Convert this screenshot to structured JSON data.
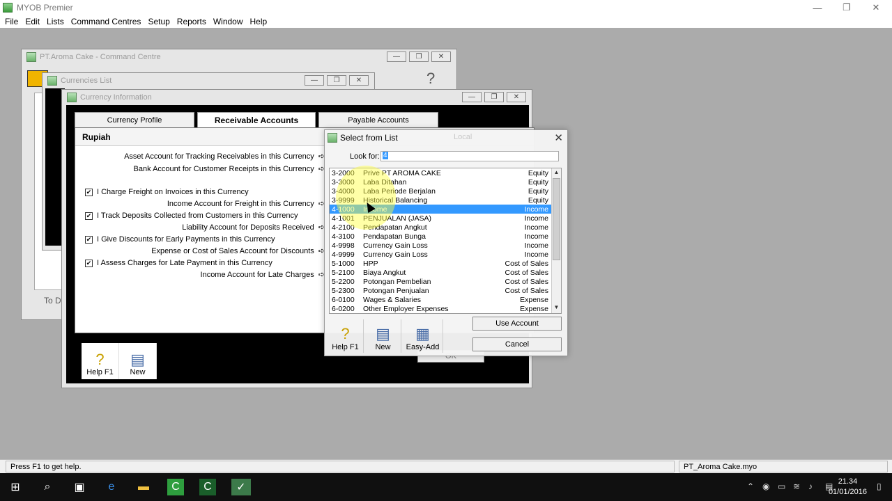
{
  "app": {
    "title": "MYOB Premier",
    "window_controls": [
      "—",
      "❐",
      "✕"
    ]
  },
  "menu": [
    "File",
    "Edit",
    "Lists",
    "Command Centres",
    "Setup",
    "Reports",
    "Window",
    "Help"
  ],
  "command_centre": {
    "title": "PT.Aroma Cake - Command Centre",
    "partial_text": "To D"
  },
  "currencies_list": {
    "title": "Currencies List"
  },
  "currency_info": {
    "title": "Currency Information",
    "tabs": [
      "Currency Profile",
      "Receivable Accounts",
      "Payable Accounts"
    ],
    "currency_name": "Rupiah",
    "rows": {
      "asset_account": "Asset Account for Tracking Receivables in this Currency",
      "bank_account": "Bank Account for Customer Receipts in this Currency",
      "charge_freight": "I Charge Freight on Invoices in this Currency",
      "income_freight": "Income Account for Freight in this Currency",
      "track_deposits": "I Track Deposits Collected from Customers in this Currency",
      "liability_deposits": "Liability Account for Deposits Received",
      "give_discounts": "I Give Discounts for Early Payments in this Currency",
      "expense_discounts": "Expense or Cost of Sales Account for Discounts",
      "assess_charges": "I Assess Charges for Late Payment in this Currency",
      "income_late": "Income Account for Late Charges"
    },
    "checkmark": "✔",
    "arrow": "➪",
    "tools": {
      "help": "Help F1",
      "new": "New"
    },
    "ok_label": "OK"
  },
  "select_dialog": {
    "title": "Select from List",
    "ghost_label": "Local",
    "look_for_label": "Look for:",
    "look_for_value": "4",
    "accounts": [
      {
        "code": "3-2000",
        "name": "Prive PT AROMA CAKE",
        "type": "Equity"
      },
      {
        "code": "3-3000",
        "name": "Laba Ditahan",
        "type": "Equity"
      },
      {
        "code": "3-4000",
        "name": "Laba Periode Berjalan",
        "type": "Equity"
      },
      {
        "code": "3-9999",
        "name": "Historical Balancing",
        "type": "Equity"
      },
      {
        "code": "4-1000",
        "name": "Income",
        "type": "Income"
      },
      {
        "code": "4-1001",
        "name": "PENJUALAN (JASA)",
        "type": "Income"
      },
      {
        "code": "4-2100",
        "name": "Pendapatan Angkut",
        "type": "Income"
      },
      {
        "code": "4-3100",
        "name": "Pendapatan Bunga",
        "type": "Income"
      },
      {
        "code": "4-9998",
        "name": "Currency Gain Loss",
        "type": "Income"
      },
      {
        "code": "4-9999",
        "name": "Currency Gain Loss",
        "type": "Income"
      },
      {
        "code": "5-1000",
        "name": "HPP",
        "type": "Cost of Sales"
      },
      {
        "code": "5-2100",
        "name": "Biaya Angkut",
        "type": "Cost of Sales"
      },
      {
        "code": "5-2200",
        "name": "Potongan Pembelian",
        "type": "Cost of Sales"
      },
      {
        "code": "5-2300",
        "name": "Potongan Penjualan",
        "type": "Cost of Sales"
      },
      {
        "code": "6-0100",
        "name": "Wages & Salaries",
        "type": "Expense"
      },
      {
        "code": "6-0200",
        "name": "Other Employer Expenses",
        "type": "Expense"
      }
    ],
    "selected_index": 4,
    "use_account": "Use Account",
    "cancel": "Cancel",
    "tools": {
      "help": "Help F1",
      "new": "New",
      "easy_add": "Easy-Add"
    }
  },
  "status": {
    "left": "Press F1 to get help.",
    "right": "PT_Aroma Cake.myo"
  },
  "taskbar": {
    "time": "21.34",
    "date": "01/01/2016"
  }
}
